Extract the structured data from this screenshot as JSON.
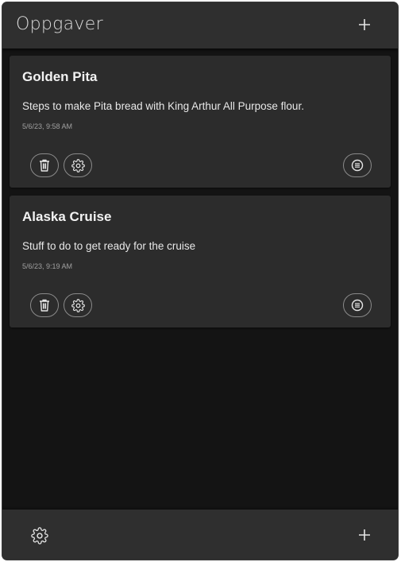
{
  "header": {
    "title": "Oppgaver",
    "add_icon": "plus-icon"
  },
  "cards": [
    {
      "title": "Golden Pita",
      "description": "Steps to make Pita bread with King Arthur All Purpose flour.",
      "date": "5/6/23, 9:58 AM",
      "actions": [
        "trash-icon",
        "gear-icon",
        "list-icon"
      ]
    },
    {
      "title": "Alaska Cruise",
      "description": "Stuff to do to get ready for the cruise",
      "date": "5/6/23, 9:19 AM",
      "actions": [
        "trash-icon",
        "gear-icon",
        "list-icon"
      ]
    }
  ],
  "footer": {
    "settings_icon": "gear-icon",
    "add_icon": "plus-icon"
  },
  "colors": {
    "background": "#141414",
    "bar": "#2f2f2f",
    "card": "#2c2c2c",
    "text": "#f2f2f2",
    "muted": "#a0a0a0"
  }
}
